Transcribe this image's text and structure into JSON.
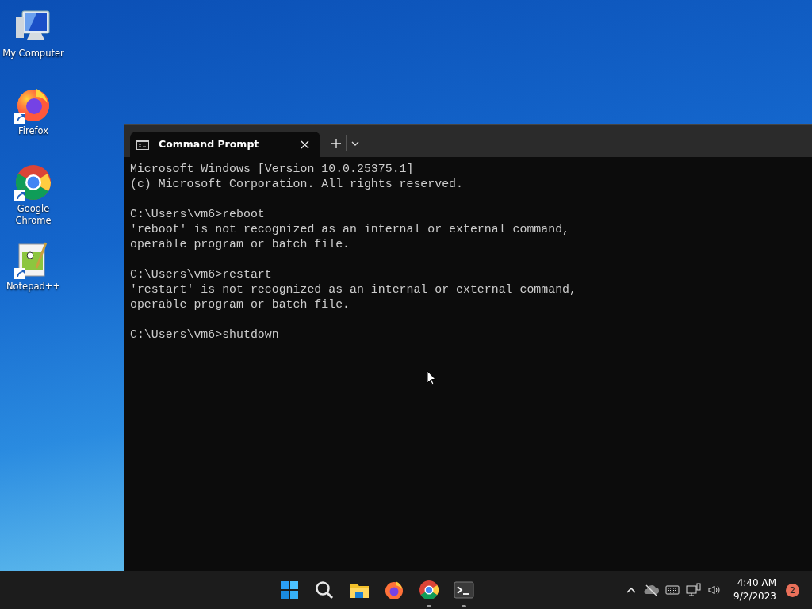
{
  "desktop_icons": [
    {
      "kind": "computer",
      "label": "My Computer",
      "shortcut": false
    },
    {
      "kind": "firefox",
      "label": "Firefox",
      "shortcut": true
    },
    {
      "kind": "chrome",
      "label": "Google Chrome",
      "shortcut": true
    },
    {
      "kind": "notepad",
      "label": "Notepad++",
      "shortcut": true
    }
  ],
  "terminal": {
    "tabs": [
      {
        "title": "Command Prompt",
        "selected": true
      }
    ],
    "blocks": [
      {
        "lines": [
          "Microsoft Windows [Version 10.0.25375.1]",
          "(c) Microsoft Corporation. All rights reserved."
        ]
      },
      {
        "lines": [
          "C:\\Users\\vm6>reboot",
          "'reboot' is not recognized as an internal or external command,",
          "operable program or batch file."
        ]
      },
      {
        "lines": [
          "C:\\Users\\vm6>restart",
          "'restart' is not recognized as an internal or external command,",
          "operable program or batch file."
        ]
      },
      {
        "lines": [
          "C:\\Users\\vm6>shutdown"
        ]
      }
    ]
  },
  "taskbar": {
    "apps": [
      {
        "kind": "start",
        "running": false
      },
      {
        "kind": "search",
        "running": false
      },
      {
        "kind": "explorer",
        "running": false
      },
      {
        "kind": "firefox",
        "running": false
      },
      {
        "kind": "chrome",
        "running": true
      },
      {
        "kind": "terminal",
        "running": true
      }
    ],
    "time": "4:40 AM",
    "date": "9/2/2023",
    "notifications": "2"
  }
}
